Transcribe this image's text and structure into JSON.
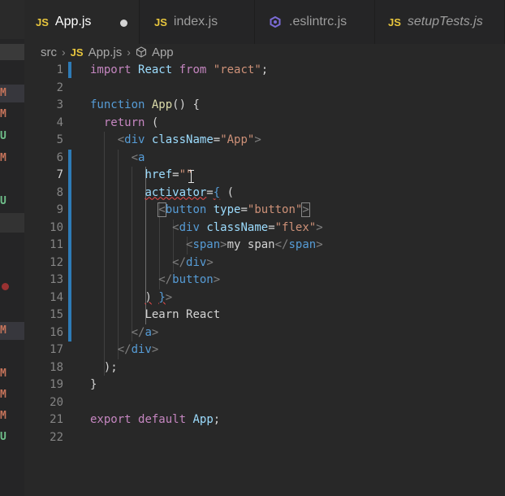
{
  "sidebar": {
    "markers": [
      {
        "letter": "M",
        "color": "#c4735a",
        "highlight": true
      },
      {
        "letter": "M",
        "color": "#c4735a",
        "highlight": false
      },
      {
        "letter": "U",
        "color": "#6fbf8a",
        "highlight": false
      },
      {
        "letter": "M",
        "color": "#c4735a",
        "highlight": false
      },
      {
        "letter": "U",
        "color": "#6fbf8a",
        "highlight": false
      },
      {
        "letter": "M",
        "color": "#c4735a",
        "highlight": true
      },
      {
        "letter": "M",
        "color": "#c4735a",
        "highlight": false
      },
      {
        "letter": "M",
        "color": "#c4735a",
        "highlight": false
      },
      {
        "letter": "M",
        "color": "#c4735a",
        "highlight": false
      },
      {
        "letter": "U",
        "color": "#6fbf8a",
        "highlight": false
      }
    ]
  },
  "tabs": [
    {
      "icon": "JS",
      "label": "App.js",
      "active": true,
      "modified": true
    },
    {
      "icon": "JS",
      "label": "index.js",
      "active": false
    },
    {
      "icon": "eslint-icon",
      "label": ".eslintrc.js",
      "active": false
    },
    {
      "icon": "JS",
      "label": "setupTests.js",
      "active": false,
      "italic": true
    }
  ],
  "breadcrumb": {
    "folder": "src",
    "file_icon": "JS",
    "file": "App.js",
    "symbol": "App"
  },
  "editor": {
    "line_numbers": [
      "1",
      "2",
      "3",
      "4",
      "5",
      "6",
      "7",
      "8",
      "9",
      "10",
      "11",
      "12",
      "13",
      "14",
      "15",
      "16",
      "17",
      "18",
      "19",
      "20",
      "21",
      "22"
    ],
    "active_line": "7",
    "colors": {
      "keyword": "#c586c0",
      "function": "#dcdcaa",
      "tag": "#569cd6",
      "attribute": "#9cdcfe",
      "string": "#ce9178",
      "gutter_modified": "#2e7bb6"
    }
  }
}
